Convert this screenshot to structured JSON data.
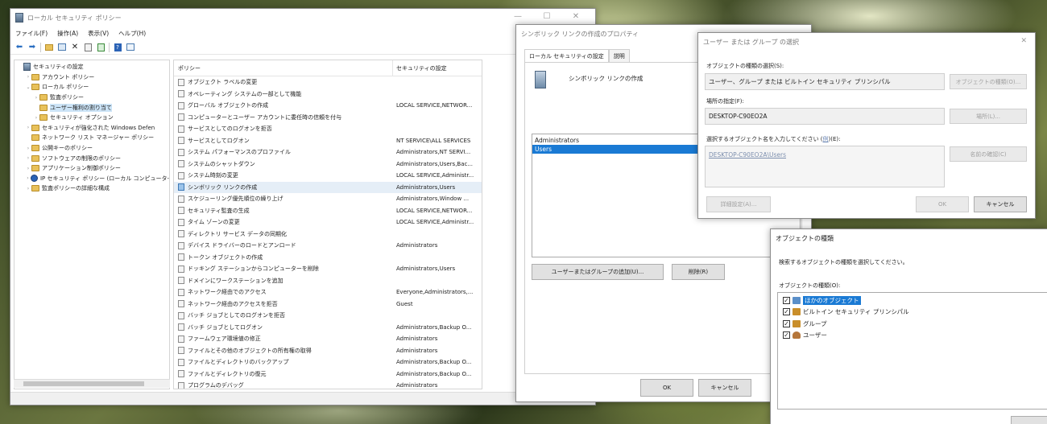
{
  "main_window": {
    "title": "ローカル セキュリティ ポリシー",
    "caption": {
      "min": "—",
      "max": "☐",
      "close": "✕"
    },
    "menu": [
      "ファイル(F)",
      "操作(A)",
      "表示(V)",
      "ヘルプ(H)"
    ],
    "toolbar_icons": [
      "back-arrow-icon",
      "forward-arrow-icon",
      "folder-up-icon",
      "show-hide-tree-icon",
      "delete-icon",
      "properties-icon",
      "export-icon",
      "help-icon",
      "view-icon"
    ],
    "tree": [
      {
        "label": "セキュリティの設定",
        "indent": 0,
        "arrow": "",
        "icon": "security"
      },
      {
        "label": "アカウント ポリシー",
        "indent": 1,
        "arrow": "›",
        "icon": "folder"
      },
      {
        "label": "ローカル ポリシー",
        "indent": 1,
        "arrow": "⌄",
        "icon": "folder"
      },
      {
        "label": "監査ポリシー",
        "indent": 2,
        "arrow": "›",
        "icon": "folder"
      },
      {
        "label": "ユーザー権利の割り当て",
        "indent": 2,
        "arrow": "",
        "icon": "folder",
        "selected": true
      },
      {
        "label": "セキュリティ オプション",
        "indent": 2,
        "arrow": "›",
        "icon": "folder"
      },
      {
        "label": "セキュリティが強化された Windows Defen",
        "indent": 1,
        "arrow": "›",
        "icon": "folder"
      },
      {
        "label": "ネットワーク リスト マネージャー ポリシー",
        "indent": 1,
        "arrow": "",
        "icon": "folder"
      },
      {
        "label": "公開キーのポリシー",
        "indent": 1,
        "arrow": "›",
        "icon": "folder"
      },
      {
        "label": "ソフトウェアの制限のポリシー",
        "indent": 1,
        "arrow": "›",
        "icon": "folder"
      },
      {
        "label": "アプリケーション制御ポリシー",
        "indent": 1,
        "arrow": "›",
        "icon": "folder"
      },
      {
        "label": "IP セキュリティ ポリシー (ローカル コンピュータ-",
        "indent": 1,
        "arrow": "›",
        "icon": "ip"
      },
      {
        "label": "監査ポリシーの詳細な構成",
        "indent": 1,
        "arrow": "›",
        "icon": "folder"
      }
    ],
    "columns": [
      "ポリシー",
      "セキュリティの設定"
    ],
    "rows": [
      {
        "policy": "オブジェクト ラベルの変更",
        "setting": ""
      },
      {
        "policy": "オペレーティング システムの一部として機能",
        "setting": ""
      },
      {
        "policy": "グローバル オブジェクトの作成",
        "setting": "LOCAL SERVICE,NETWOR..."
      },
      {
        "policy": "コンピューターとユーザー アカウントに委任時の信頼を付与",
        "setting": ""
      },
      {
        "policy": "サービスとしてのログオンを拒否",
        "setting": ""
      },
      {
        "policy": "サービスとしてログオン",
        "setting": "NT SERVICE\\ALL SERVICES"
      },
      {
        "policy": "システム パフォーマンスのプロファイル",
        "setting": "Administrators,NT SERVI..."
      },
      {
        "policy": "システムのシャットダウン",
        "setting": "Administrators,Users,Bac..."
      },
      {
        "policy": "システム時刻の変更",
        "setting": "LOCAL SERVICE,Administr..."
      },
      {
        "policy": "シンボリック リンクの作成",
        "setting": "Administrators,Users",
        "selected": true
      },
      {
        "policy": "スケジューリング優先順位の繰り上げ",
        "setting": "Administrators,Window ..."
      },
      {
        "policy": "セキュリティ監査の生成",
        "setting": "LOCAL SERVICE,NETWOR..."
      },
      {
        "policy": "タイム ゾーンの変更",
        "setting": "LOCAL SERVICE,Administr..."
      },
      {
        "policy": "ディレクトリ サービス データの同期化",
        "setting": ""
      },
      {
        "policy": "デバイス ドライバーのロードとアンロード",
        "setting": "Administrators"
      },
      {
        "policy": "トークン オブジェクトの作成",
        "setting": ""
      },
      {
        "policy": "ドッキング ステーションからコンピューターを削除",
        "setting": "Administrators,Users"
      },
      {
        "policy": "ドメインにワークステーションを追加",
        "setting": ""
      },
      {
        "policy": "ネットワーク経由でのアクセス",
        "setting": "Everyone,Administrators,..."
      },
      {
        "policy": "ネットワーク経由のアクセスを拒否",
        "setting": "Guest"
      },
      {
        "policy": "バッチ ジョブとしてのログオンを拒否",
        "setting": ""
      },
      {
        "policy": "バッチ ジョブとしてログオン",
        "setting": "Administrators,Backup O..."
      },
      {
        "policy": "ファームウェア環境値の修正",
        "setting": "Administrators"
      },
      {
        "policy": "ファイルとその他のオブジェクトの所有権の取得",
        "setting": "Administrators"
      },
      {
        "policy": "ファイルとディレクトリのバックアップ",
        "setting": "Administrators,Backup O..."
      },
      {
        "policy": "ファイルとディレクトリの復元",
        "setting": "Administrators,Backup O..."
      },
      {
        "policy": "プログラムのデバッグ",
        "setting": "Administrators"
      }
    ]
  },
  "properties_dialog": {
    "title": "シンボリック リンクの作成のプロパティ",
    "tabs": [
      "ローカル セキュリティの設定",
      "説明"
    ],
    "heading": "シンボリック リンクの作成",
    "members": [
      {
        "name": "Administrators",
        "selected": false
      },
      {
        "name": "Users",
        "selected": true
      }
    ],
    "add_button": "ユーザーまたはグループの追加(U)...",
    "remove_button": "削除(R)",
    "ok": "OK",
    "cancel": "キャンセル"
  },
  "select_dialog": {
    "title": "ユーザー または グループ の選択",
    "object_type_label": "オブジェクトの種類の選択(S):",
    "object_type_value": "ユーザー、グループ または ビルトイン セキュリティ プリンシパル",
    "object_type_button": "オブジェクトの種類(O)...",
    "location_label": "場所の指定(F):",
    "location_value": "DESKTOP-C90EO2A",
    "location_button": "場所(L)...",
    "names_label_pre": "選択するオブジェクト名を入力してください (",
    "names_label_link": "例",
    "names_label_post": ")(E):",
    "names_value": "DESKTOP-C90EO2A\\Users",
    "check_names_button": "名前の確認(C)",
    "advanced_button": "詳細設定(A)...",
    "ok": "OK",
    "cancel": "キャンセル",
    "close": "✕"
  },
  "object_types_dialog": {
    "title": "オブジェクトの種類",
    "instruction": "検索するオブジェクトの種類を選択してください。",
    "list_label": "オブジェクトの種類(O):",
    "items": [
      {
        "label": "ほかのオブジェクト",
        "checked": true,
        "selected": true,
        "icon": "other-objects-icon"
      },
      {
        "label": "ビルトイン セキュリティ プリンシパル",
        "checked": true,
        "selected": false,
        "icon": "builtin-principal-icon"
      },
      {
        "label": "グループ",
        "checked": true,
        "selected": false,
        "icon": "group-icon"
      },
      {
        "label": "ユーザー",
        "checked": true,
        "selected": false,
        "icon": "user-icon"
      }
    ],
    "check_mark": "✓"
  }
}
